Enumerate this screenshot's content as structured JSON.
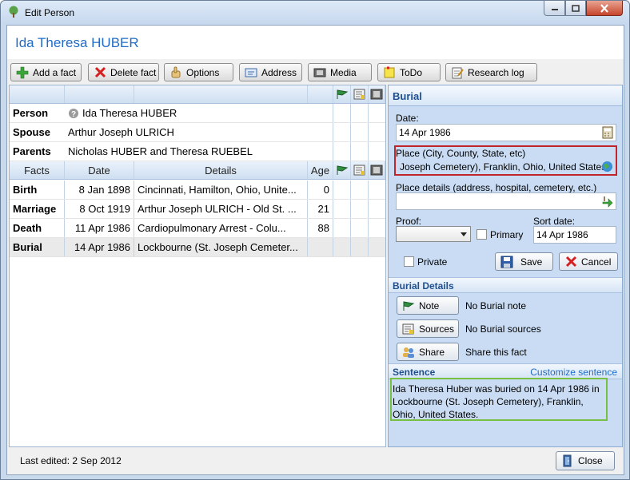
{
  "window": {
    "title": "Edit Person"
  },
  "person_title": "Ida Theresa HUBER",
  "toolbar": {
    "add_fact": "Add a fact",
    "delete_fact": "Delete fact",
    "options": "Options",
    "address": "Address",
    "media": "Media",
    "todo": "ToDo",
    "research_log": "Research log"
  },
  "relations": [
    {
      "label": "Person",
      "value": "Ida Theresa HUBER"
    },
    {
      "label": "Spouse",
      "value": "Arthur Joseph ULRICH"
    },
    {
      "label": "Parents",
      "value": "Nicholas HUBER and Theresa RUEBEL"
    }
  ],
  "facts_header": {
    "facts": "Facts",
    "date": "Date",
    "details": "Details",
    "age": "Age"
  },
  "facts": [
    {
      "fact": "Birth",
      "date": "8 Jan 1898",
      "details": "Cincinnati, Hamilton, Ohio, Unite...",
      "age": "0"
    },
    {
      "fact": "Marriage",
      "date": "8 Oct 1919",
      "details": "Arthur Joseph ULRICH - Old St. ...",
      "age": "21"
    },
    {
      "fact": "Death",
      "date": "11 Apr 1986",
      "details": "Cardiopulmonary Arrest - Colu...",
      "age": "88"
    },
    {
      "fact": "Burial",
      "date": "14 Apr 1986",
      "details": "Lockbourne (St. Joseph Cemeter...",
      "age": ""
    }
  ],
  "panel": {
    "title": "Burial",
    "date_label": "Date:",
    "date_value": "14 Apr 1986",
    "place_label": "Place (City, County, State, etc)",
    "place_value": "Joseph Cemetery), Franklin, Ohio, United States",
    "place_details_label": "Place details (address, hospital, cemetery, etc.)",
    "proof_label": "Proof:",
    "primary_label": "Primary",
    "sort_date_label": "Sort date:",
    "sort_date_value": "14 Apr 1986",
    "private_label": "Private",
    "save": "Save",
    "cancel": "Cancel",
    "details_title": "Burial Details",
    "note_btn": "Note",
    "note_status": "No Burial note",
    "sources_btn": "Sources",
    "sources_status": "No Burial sources",
    "share_btn": "Share",
    "share_status": "Share this fact",
    "sentence_title": "Sentence",
    "customize_link": "Customize sentence",
    "sentence": "Ida Theresa Huber was buried on 14 Apr 1986 in Lockbourne (St. Joseph Cemetery), Franklin, Ohio, United States."
  },
  "footer": {
    "last_edited": "Last edited: 2 Sep 2012",
    "close": "Close"
  },
  "colors": {
    "accent": "#1f6bc7",
    "panel_bg": "#c9dcf3",
    "highlight_red": "#c0252a",
    "highlight_green": "#77c043"
  }
}
